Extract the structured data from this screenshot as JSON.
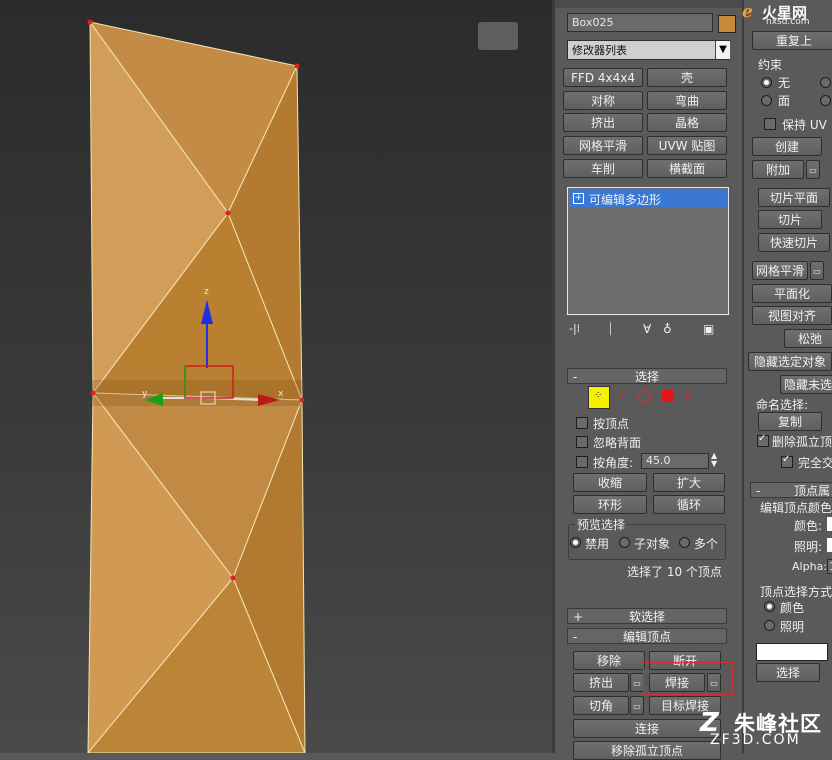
{
  "viewport": {
    "label": "",
    "axes": {
      "x": "x",
      "y": "y",
      "z": "z"
    }
  },
  "panel": {
    "object_name": "Box025",
    "object_color": "#c88a3a",
    "modifier_list": "修改器列表",
    "modifier_buttons": [
      "FFD 4x4x4",
      "壳",
      "对称",
      "弯曲",
      "挤出",
      "晶格",
      "网格平滑",
      "UVW 贴图",
      "车削",
      "横截面"
    ],
    "stack_item": "可编辑多边形",
    "selection": {
      "title": "选择",
      "by_vertex": "按顶点",
      "ignore_backface": "忽略背面",
      "by_angle": "按角度:",
      "angle_value": "45.0",
      "shrink": "收缩",
      "grow": "扩大",
      "ring": "环形",
      "loop": "循环",
      "preview_title": "预览选择",
      "preview_options": [
        "禁用",
        "子对象",
        "多个"
      ],
      "status": "选择了 10 个顶点"
    },
    "soft_selection": {
      "title": "软选择"
    },
    "edit_vertices": {
      "title": "编辑顶点",
      "remove": "移除",
      "break": "断开",
      "extrude": "挤出",
      "weld": "焊接",
      "chamfer": "切角",
      "target_weld": "目标焊接",
      "connect": "连接",
      "remove_isolated": "移除孤立顶点"
    }
  },
  "rpanel": {
    "reset": "重复上",
    "constraints_title": "约束",
    "constraints": [
      "无",
      "面"
    ],
    "preserve_uv": "保持 UV",
    "create": "创建",
    "attach": "附加",
    "slice_plane": "切片平面",
    "slice": "切片",
    "quick_slice": "快速切片",
    "meshsmooth": "网格平滑",
    "planarize": "平面化",
    "view_align": "视图对齐",
    "relax": "松弛",
    "hide_selected": "隐藏选定对象",
    "unhide_all": "隐藏未选",
    "named_sel": "命名选择:",
    "copy": "复制",
    "delete_isolated": "删除孤立顶",
    "full_interactive": "完全交",
    "vertex_props": "顶点属",
    "edit_vertex_color": "编辑顶点颜色",
    "color": "颜色:",
    "illum": "照明:",
    "alpha": "Alpha:",
    "alpha_value": "1",
    "vertex_select_by": "顶点选择方式",
    "select_by": [
      "颜色",
      "照明"
    ],
    "select": "选择"
  },
  "watermarks": {
    "top": "火星网",
    "top_sub": "hxsd.com",
    "bottom": "朱峰社区",
    "bottom_sub": "ZF3D.COM"
  },
  "colors": {
    "accent_blue": "#3a78d4",
    "highlight_red": "#d03030",
    "select_yellow": "#f5f000"
  }
}
